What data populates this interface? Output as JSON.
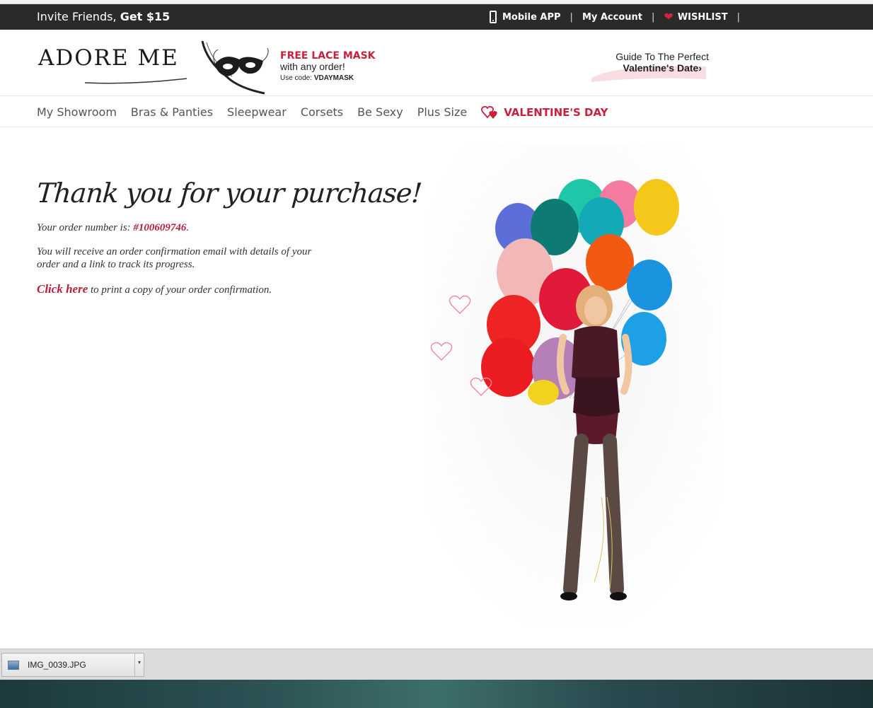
{
  "topbar": {
    "invite_text": "Invite Friends, ",
    "invite_bold": "Get $15",
    "mobile_app": "Mobile APP",
    "separator": "|",
    "my_account": "My Account",
    "wishlist": "WISHLIST"
  },
  "header": {
    "logo": "ADORE ME",
    "promo_title": "FREE LACE MASK",
    "promo_sub": "with any order!",
    "promo_code_label": "Use code: ",
    "promo_code": "VDAYMASK",
    "guide_line1": "Guide To The Perfect",
    "guide_line2": "Valentine's Date",
    "guide_arrow": "›"
  },
  "nav": {
    "items": [
      "My Showroom",
      "Bras & Panties",
      "Sleepwear",
      "Corsets",
      "Be Sexy",
      "Plus Size"
    ],
    "valentines": "VALENTINE'S DAY"
  },
  "main": {
    "heading": "Thank you for your purchase!",
    "order_prefix": "Your order number is: ",
    "order_number": "#100609746",
    "order_suffix": ".",
    "confirmation_text": "You will receive an order confirmation email with details of your order and a link to track its progress.",
    "click_here": "Click here",
    "print_text": " to print a copy of your order confirmation."
  },
  "download_bar": {
    "filename": "IMG_0039.JPG",
    "caret": "▾"
  },
  "colors": {
    "brand_red": "#c8203d",
    "topbar_bg": "#2a2a2a"
  }
}
